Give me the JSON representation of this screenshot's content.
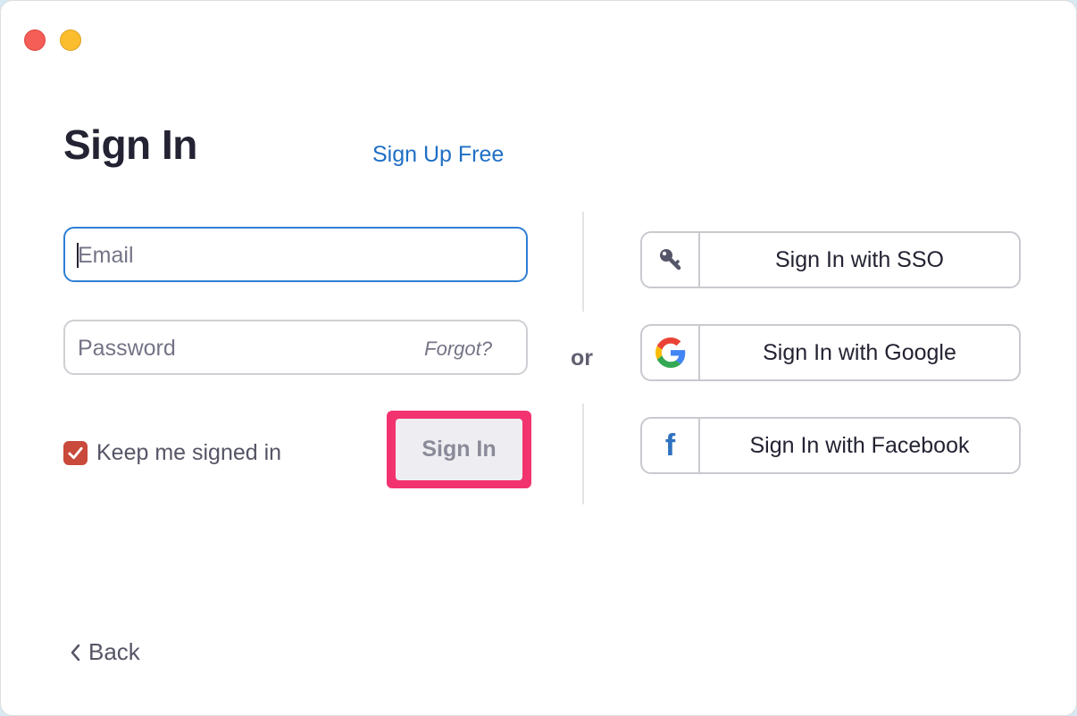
{
  "window": {
    "controls": [
      "close",
      "minimize"
    ]
  },
  "header": {
    "title": "Sign In",
    "signup_link": "Sign Up Free"
  },
  "form": {
    "email": {
      "placeholder": "Email",
      "value": ""
    },
    "password": {
      "placeholder": "Password",
      "value": ""
    },
    "forgot_link": "Forgot?",
    "keep_signed_in": {
      "label": "Keep me signed in",
      "checked": true
    },
    "submit_label": "Sign In"
  },
  "separator": {
    "label": "or"
  },
  "providers": [
    {
      "label": "Sign In with SSO",
      "icon": "key-icon"
    },
    {
      "label": "Sign In with Google",
      "icon": "google-icon"
    },
    {
      "label": "Sign In with Facebook",
      "icon": "facebook-icon"
    }
  ],
  "footer": {
    "back_label": "Back"
  },
  "colors": {
    "link": "#1f6fc5",
    "focus_border": "#2d7fd4",
    "checkbox": "#c9493b",
    "highlight": "#f2336f"
  }
}
